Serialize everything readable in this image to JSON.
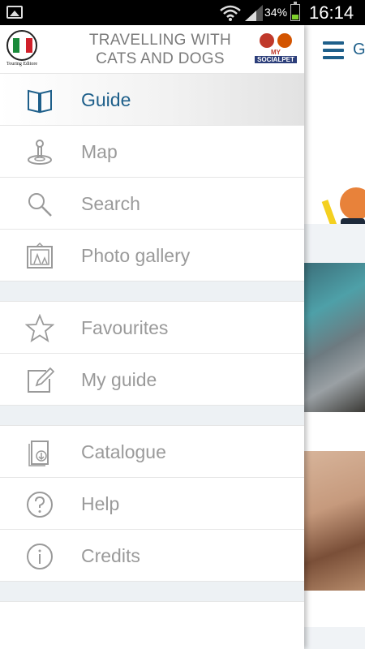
{
  "status_bar": {
    "battery_percent": "34%",
    "time": "16:14",
    "battery_level": 0.34,
    "icons": [
      "image-icon",
      "wifi-icon",
      "signal-icon",
      "battery-icon"
    ]
  },
  "app": {
    "title_line1": "TRAVELLING WITH",
    "title_line2": "CATS AND DOGS",
    "publisher_caption": "Touring Editore",
    "social_logo_line1": "MY",
    "social_logo_line2": "SOCIALPET"
  },
  "background_page": {
    "title_partial": "G"
  },
  "menu": {
    "group1": [
      {
        "label": "Guide",
        "icon": "book-icon",
        "active": true
      },
      {
        "label": "Map",
        "icon": "map-pin-icon",
        "active": false
      },
      {
        "label": "Search",
        "icon": "search-icon",
        "active": false
      },
      {
        "label": "Photo gallery",
        "icon": "photo-frame-icon",
        "active": false
      }
    ],
    "group2": [
      {
        "label": "Favourites",
        "icon": "star-icon",
        "active": false
      },
      {
        "label": "My guide",
        "icon": "edit-icon",
        "active": false
      }
    ],
    "group3": [
      {
        "label": "Catalogue",
        "icon": "catalogue-download-icon",
        "active": false
      },
      {
        "label": "Help",
        "icon": "help-icon",
        "active": false
      },
      {
        "label": "Credits",
        "icon": "info-icon",
        "active": false
      }
    ]
  },
  "colors": {
    "accent": "#1e5f8a",
    "inactive_text": "#9a9a9a",
    "separator": "#edf1f4",
    "status_bar": "#000000"
  }
}
